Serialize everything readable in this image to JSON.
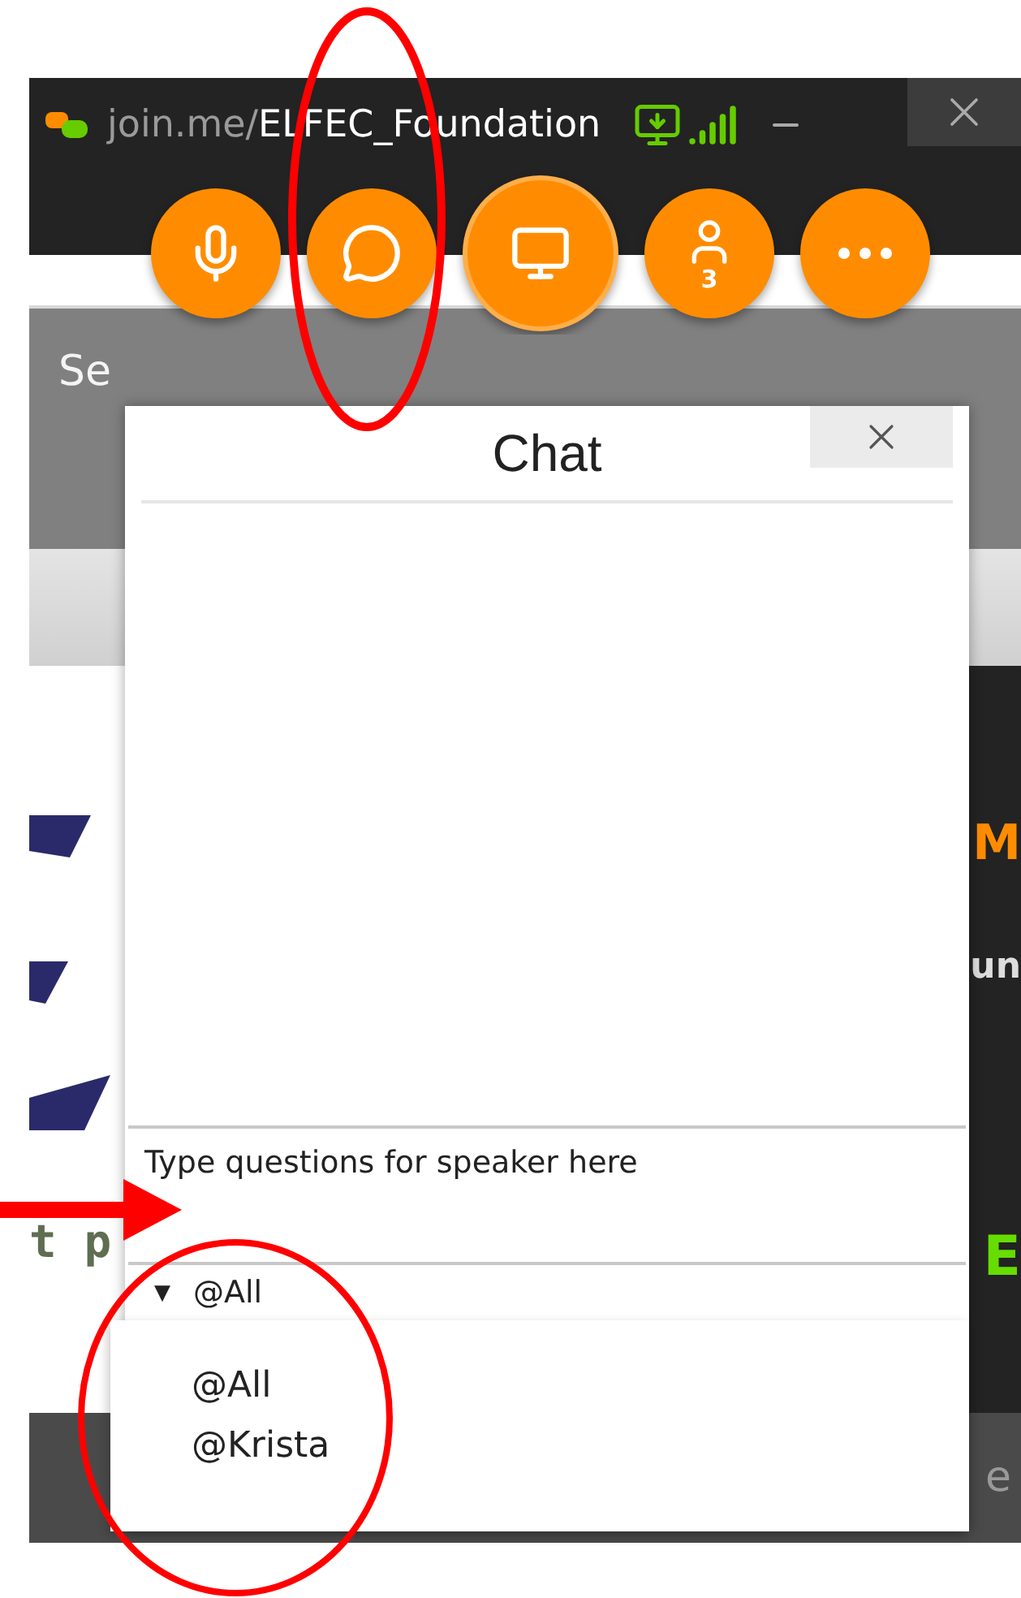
{
  "window": {
    "url_prefix": "join.me/",
    "meeting_name": "ELFEC_Foundation"
  },
  "toolbar": [
    {
      "kind": "mic",
      "selected": false
    },
    {
      "kind": "chat",
      "selected": false
    },
    {
      "kind": "screen",
      "selected": true
    },
    {
      "kind": "people",
      "selected": false,
      "badge": "3"
    },
    {
      "kind": "more",
      "selected": false
    }
  ],
  "background": {
    "header_text": "Se",
    "left_text": "t p",
    "right_texts": [
      "M",
      "un",
      "E"
    ],
    "bottom_text": "e"
  },
  "chat": {
    "title": "Chat",
    "input": {
      "placeholder": "Type questions for speaker here"
    },
    "recipient": {
      "caret": "▼",
      "value": "@All",
      "expanded": true,
      "options": [
        {
          "label": "@All"
        },
        {
          "label": "@Krista"
        }
      ]
    }
  }
}
